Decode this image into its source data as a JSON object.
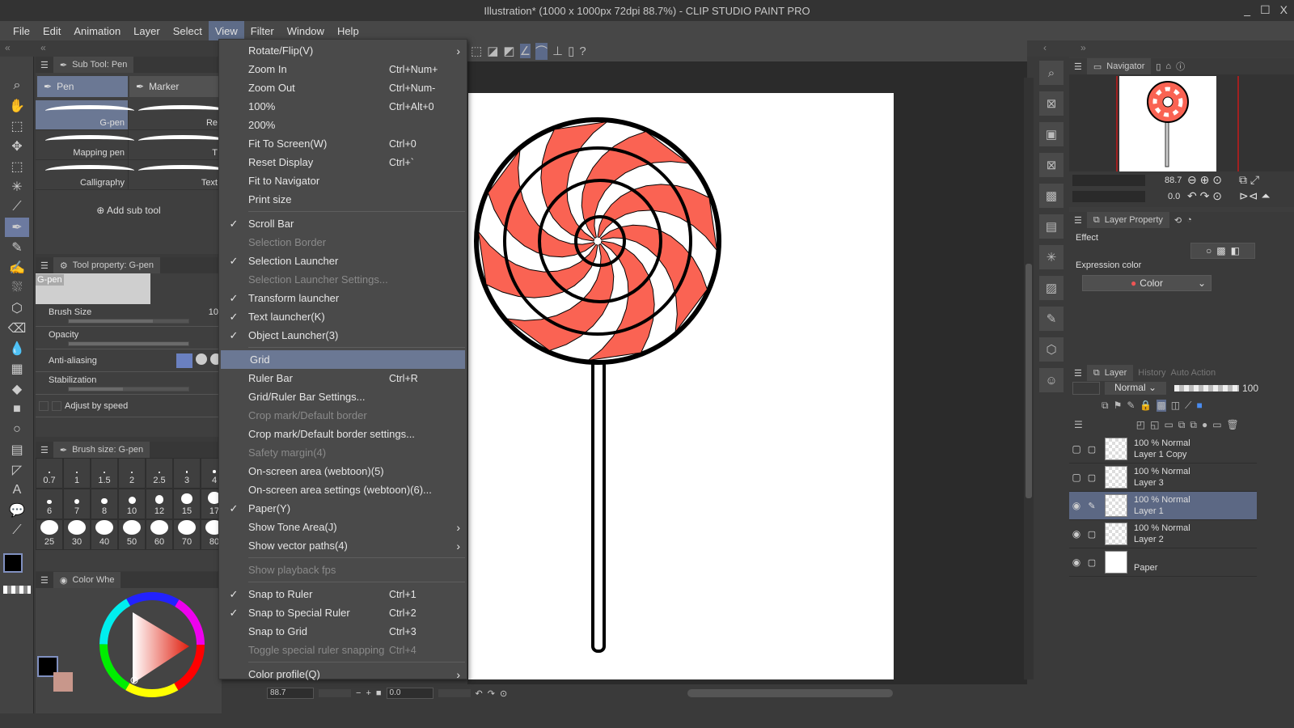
{
  "window": {
    "title": "Illustration* (1000 x 1000px 72dpi 88.7%)  - CLIP STUDIO PAINT PRO",
    "controls": [
      "_",
      "☐",
      "X"
    ]
  },
  "menubar": [
    "File",
    "Edit",
    "Animation",
    "Layer",
    "Select",
    "View",
    "Filter",
    "Window",
    "Help"
  ],
  "active_menu": "View",
  "view_menu": [
    {
      "label": "Rotate/Flip(V)",
      "shortcut": "",
      "submenu": true
    },
    {
      "label": "Zoom In",
      "shortcut": "Ctrl+Num+"
    },
    {
      "label": "Zoom Out",
      "shortcut": "Ctrl+Num-"
    },
    {
      "label": "100%",
      "shortcut": "Ctrl+Alt+0"
    },
    {
      "label": "200%",
      "shortcut": ""
    },
    {
      "label": "Fit To Screen(W)",
      "shortcut": "Ctrl+0"
    },
    {
      "label": "Reset Display",
      "shortcut": "Ctrl+`"
    },
    {
      "label": "Fit to Navigator",
      "shortcut": ""
    },
    {
      "label": "Print size",
      "shortcut": ""
    },
    {
      "sep": true
    },
    {
      "label": "Scroll Bar",
      "checked": true
    },
    {
      "label": "Selection Border",
      "disabled": true
    },
    {
      "label": "Selection Launcher",
      "checked": true
    },
    {
      "label": "Selection Launcher Settings...",
      "disabled": true
    },
    {
      "label": "Transform launcher",
      "checked": true
    },
    {
      "label": "Text launcher(K)",
      "checked": true
    },
    {
      "label": "Object Launcher(3)",
      "checked": true
    },
    {
      "sep": true
    },
    {
      "label": "Grid",
      "highlighted": true
    },
    {
      "label": "Ruler Bar",
      "shortcut": "Ctrl+R"
    },
    {
      "label": "Grid/Ruler Bar Settings..."
    },
    {
      "label": "Crop mark/Default border",
      "disabled": true
    },
    {
      "label": "Crop mark/Default border settings..."
    },
    {
      "label": "Safety margin(4)",
      "disabled": true
    },
    {
      "label": "On-screen area (webtoon)(5)"
    },
    {
      "label": "On-screen area settings (webtoon)(6)..."
    },
    {
      "label": "Paper(Y)",
      "checked": true
    },
    {
      "label": "Show Tone Area(J)",
      "submenu": true
    },
    {
      "label": "Show vector paths(4)",
      "submenu": true
    },
    {
      "sep": true
    },
    {
      "label": "Show playback fps",
      "disabled": true
    },
    {
      "sep": true
    },
    {
      "label": "Snap to Ruler",
      "shortcut": "Ctrl+1",
      "checked": true
    },
    {
      "label": "Snap to Special Ruler",
      "shortcut": "Ctrl+2",
      "checked": true
    },
    {
      "label": "Snap to Grid",
      "shortcut": "Ctrl+3"
    },
    {
      "label": "Toggle special ruler snapping",
      "shortcut": "Ctrl+4",
      "disabled": true
    },
    {
      "sep": true
    },
    {
      "label": "Color profile(Q)",
      "submenu": true
    }
  ],
  "subtool": {
    "title": "Sub Tool: Pen",
    "groups": [
      "Pen",
      "Marker"
    ],
    "brushes": [
      [
        "G-pen",
        "Re"
      ],
      [
        "Mapping pen",
        "T"
      ],
      [
        "Calligraphy",
        "Text"
      ]
    ],
    "add": "Add sub tool"
  },
  "toolprop": {
    "title": "Tool property: G-pen",
    "preview_label": "G-pen",
    "brush_size_label": "Brush Size",
    "brush_size_value": "10",
    "opacity_label": "Opacity",
    "antialias_label": "Anti-aliasing",
    "stabilization_label": "Stabilization",
    "adjust_label": "Adjust by speed",
    "brush_size_fill": 0.7,
    "opacity_fill": 1.0,
    "stabilization_fill": 0.45
  },
  "brushsize": {
    "title": "Brush size: G-pen",
    "sizes": [
      "0.7",
      "1",
      "1.5",
      "2",
      "2.5",
      "3",
      "4",
      "6",
      "7",
      "8",
      "10",
      "12",
      "15",
      "17",
      "25",
      "30",
      "40",
      "50",
      "60",
      "70",
      "80"
    ]
  },
  "colorwheel": {
    "title": "Color Whe",
    "main_color": "#000000",
    "sub_color": "#c8978b"
  },
  "navigator": {
    "title": "Navigator",
    "zoom": "88.7",
    "rotate": "0.0"
  },
  "layerprop": {
    "title": "Layer Property",
    "effect": "Effect",
    "expression_label": "Expression color",
    "expression_value": "Color"
  },
  "layers": {
    "tabs": [
      "Layer",
      "History",
      "Auto Action"
    ],
    "blend": "Normal",
    "opacity": "100",
    "items": [
      {
        "mode": "100 % Normal",
        "name": "Layer 1 Copy",
        "visible": false,
        "selected": false
      },
      {
        "mode": "100 % Normal",
        "name": "Layer 3",
        "visible": false,
        "selected": false
      },
      {
        "mode": "100 % Normal",
        "name": "Layer 1",
        "visible": true,
        "selected": true
      },
      {
        "mode": "100 % Normal",
        "name": "Layer 2",
        "visible": true,
        "selected": false
      },
      {
        "mode": "",
        "name": "Paper",
        "visible": true,
        "selected": false
      }
    ]
  },
  "statusbar": {
    "zoom": "88.7",
    "rotate": "0.0"
  },
  "colors": {
    "candy_red": "#fa6353",
    "accent": "#6b7894"
  }
}
